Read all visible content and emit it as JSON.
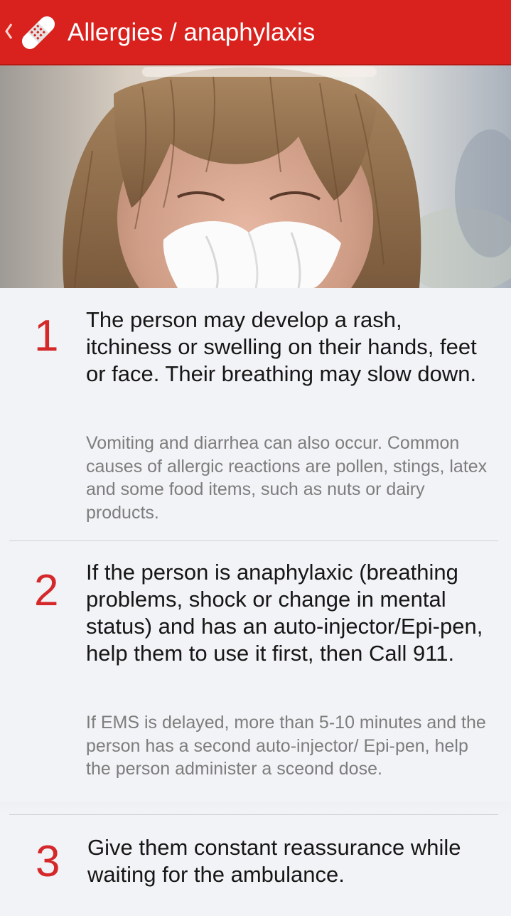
{
  "header": {
    "title": "Allergies / anaphylaxis",
    "back_icon": "chevron-left-icon",
    "app_icon": "bandage-icon",
    "bar_color": "#d9211d"
  },
  "hero_image": {
    "description_icon": "person-sneezing-photo"
  },
  "steps": [
    {
      "number": "1",
      "main": "The person may develop a rash, itchiness or swelling on their hands, feet or face. Their breathing may slow down.",
      "detail": "Vomiting and diarrhea can also occur. Common causes of allergic reactions are pollen, stings, latex and some food items, such as nuts or dairy products."
    },
    {
      "number": "2",
      "main": "If the person is anaphylaxic (breathing problems, shock or change in mental status) and has an auto-injector/Epi-pen, help them to use it first, then Call 911.",
      "detail": "If EMS is delayed, more than 5-10 minutes and the person has a second auto-injector/ Epi-pen, help the person administer a sceond dose."
    },
    {
      "number": "3",
      "main": "Give them constant reassurance while waiting for the ambulance.",
      "detail": ""
    }
  ],
  "colors": {
    "accent": "#d4282a",
    "background": "#f2f3f6"
  }
}
